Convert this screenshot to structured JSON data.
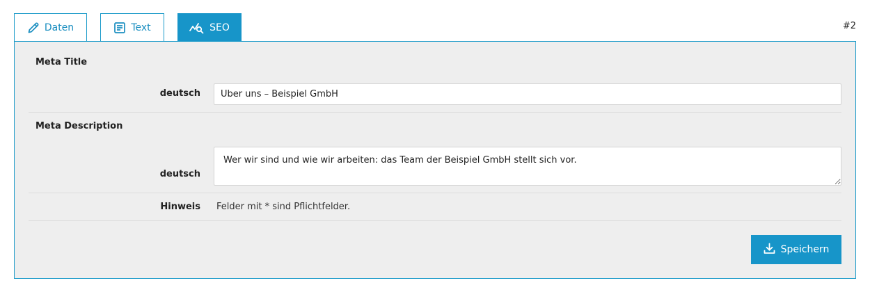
{
  "tabs": [
    {
      "label": "Daten",
      "icon": "pencil-icon",
      "active": false
    },
    {
      "label": "Text",
      "icon": "document-icon",
      "active": false
    },
    {
      "label": "SEO",
      "icon": "seo-analytics-icon",
      "active": true
    }
  ],
  "record_id": "#2",
  "colors": {
    "accent": "#1795c9",
    "panel_bg": "#eeeeee"
  },
  "meta_title": {
    "section_label": "Meta Title",
    "language_label": "deutsch",
    "value": "Über uns – Beispiel GmbH"
  },
  "meta_description": {
    "section_label": "Meta Description",
    "language_label": "deutsch",
    "value": "Wer wir sind und wie wir arbeiten: das Team der Beispiel GmbH stellt sich vor."
  },
  "hint": {
    "label": "Hinweis",
    "text": "Felder mit * sind Pflichtfelder."
  },
  "save_button": {
    "label": "Speichern",
    "icon": "download-icon"
  }
}
